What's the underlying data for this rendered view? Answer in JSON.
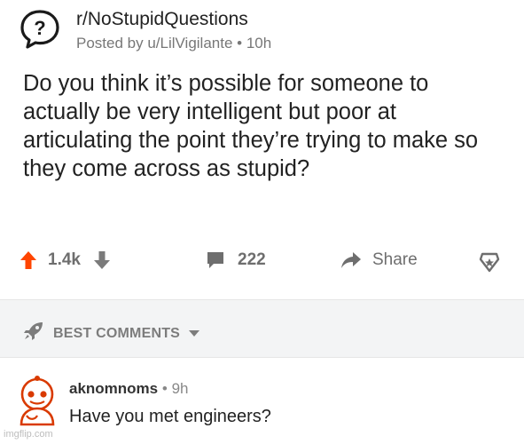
{
  "post": {
    "subreddit": "r/NoStupidQuestions",
    "posted_by": "Posted by u/LilVigilante",
    "separator": "•",
    "age": "10h",
    "title": "Do you think it’s possible for someone to actually be very intelligent but poor at articulating the point they’re trying to make so they come across as stupid?"
  },
  "actions": {
    "upvote_icon": "upvote-arrow-icon",
    "score": "1.4k",
    "downvote_icon": "downvote-arrow-icon",
    "comment_icon": "comment-bubble-icon",
    "comments_count": "222",
    "share_icon": "share-arrow-icon",
    "share_label": "Share",
    "award_icon": "award-icon",
    "upvote_color": "#ff4500"
  },
  "comments_section": {
    "sort_icon": "rocket-icon",
    "sort_label": "BEST COMMENTS",
    "sort_dropdown_icon": "caret-down-icon"
  },
  "comment": {
    "author": "aknomnoms",
    "separator": "•",
    "age": "9h",
    "body": "Have you met engineers?"
  },
  "watermark": "imgflip.com"
}
